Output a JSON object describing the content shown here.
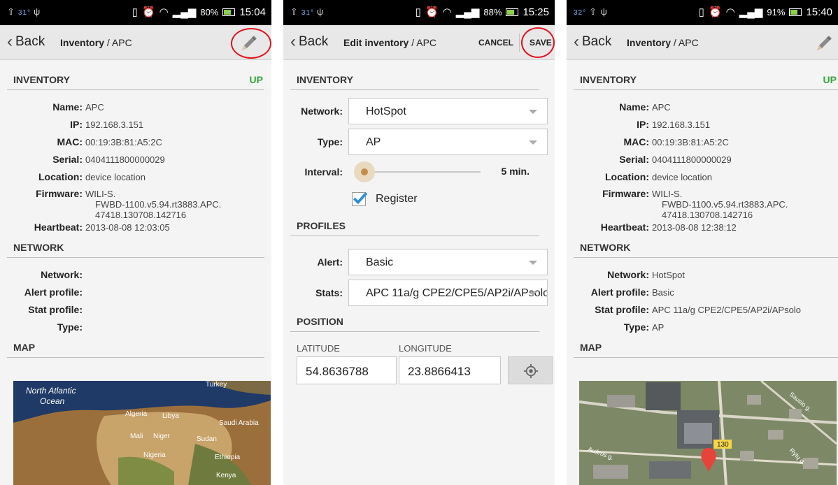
{
  "status_bars": [
    {
      "temp": "31°",
      "pct": "80%",
      "time": "15:04"
    },
    {
      "temp": "31°",
      "pct": "88%",
      "time": "15:25"
    },
    {
      "temp": "32°",
      "pct": "91%",
      "time": "15:40"
    }
  ],
  "screen1": {
    "back": "Back",
    "title_bold": "Inventory",
    "title_rest": " / APC",
    "sections": {
      "inventory": "INVENTORY",
      "network": "NETWORK",
      "map": "MAP"
    },
    "status_up": "UP",
    "fields": {
      "name_k": "Name:",
      "name_v": "APC",
      "ip_k": "IP:",
      "ip_v": "192.168.3.151",
      "mac_k": "MAC:",
      "mac_v": "00:19:3B:81:A5:2C",
      "serial_k": "Serial:",
      "serial_v": "0404111800000029",
      "location_k": "Location:",
      "location_v": "device location",
      "firmware_k": "Firmware:",
      "firmware_v1": "WILI-S.",
      "firmware_v2": "FWBD-1100.v5.94.rt3883.APC.",
      "firmware_v3": "47418.130708.142716",
      "heartbeat_k": "Heartbeat:",
      "heartbeat_v": "2013-08-08 12:03:05"
    },
    "network": {
      "network_k": "Network:",
      "network_v": "",
      "alert_k": "Alert profile:",
      "alert_v": "",
      "stat_k": "Stat profile:",
      "stat_v": "",
      "type_k": "Type:",
      "type_v": ""
    },
    "map_labels": {
      "ocean1": "North Atlantic",
      "ocean2": "Ocean",
      "turkey": "Turkey",
      "algeria": "Algeria",
      "libya": "Libya",
      "saudi": "Saudi Arabia",
      "mali": "Mali",
      "niger": "Niger",
      "sudan": "Sudan",
      "nigeria": "Nigeria",
      "ethiopia": "Ethiopia",
      "kenya": "Kenya"
    }
  },
  "screen2": {
    "back": "Back",
    "title_bold": "Edit inventory",
    "title_rest": " / APC",
    "cancel": "CANCEL",
    "save": "SAVE",
    "sections": {
      "inventory": "INVENTORY",
      "profiles": "PROFILES",
      "position": "POSITION"
    },
    "network_label": "Network:",
    "network_value": "HotSpot",
    "type_label": "Type:",
    "type_value": "AP",
    "interval_label": "Interval:",
    "interval_value": "5 min.",
    "register_label": "Register",
    "register_checked": true,
    "alert_label": "Alert:",
    "alert_value": "Basic",
    "stats_label": "Stats:",
    "stats_value": "APC 11a/g CPE2/CPE5/AP2i/APsolo",
    "latitude_label": "LATITUDE",
    "latitude_value": "54.8636788",
    "longitude_label": "LONGITUDE",
    "longitude_value": "23.8866413"
  },
  "screen3": {
    "back": "Back",
    "title_bold": "Inventory",
    "title_rest": " / APC",
    "sections": {
      "inventory": "INVENTORY",
      "network": "NETWORK",
      "map": "MAP"
    },
    "status_up": "UP",
    "fields": {
      "name_k": "Name:",
      "name_v": "APC",
      "ip_k": "IP:",
      "ip_v": "192.168.3.151",
      "mac_k": "MAC:",
      "mac_v": "00:19:3B:81:A5:2C",
      "serial_k": "Serial:",
      "serial_v": "0404111800000029",
      "location_k": "Location:",
      "location_v": "device location",
      "firmware_k": "Firmware:",
      "firmware_v1": "WILI-S.",
      "firmware_v2": "FWBD-1100.v5.94.rt3883.APC.",
      "firmware_v3": "47418.130708.142716",
      "heartbeat_k": "Heartbeat:",
      "heartbeat_v": "2013-08-08 12:38:12"
    },
    "network": {
      "network_k": "Network:",
      "network_v": "HotSpot",
      "alert_k": "Alert profile:",
      "alert_v": "Basic",
      "stat_k": "Stat profile:",
      "stat_v": "APC 11a/g CPE2/CPE5/AP2i/APsolo",
      "type_k": "Type:",
      "type_v": "AP"
    },
    "map_labels": {
      "road": "130",
      "street1": "Aušros g.",
      "street2": "Sausio g.",
      "street3": "Rytų g."
    }
  },
  "colors": {
    "status_up": "#34a53a",
    "highlight": "#e0141e",
    "map_pin": "#e8433a",
    "checkbox": "#2d8fd6"
  }
}
